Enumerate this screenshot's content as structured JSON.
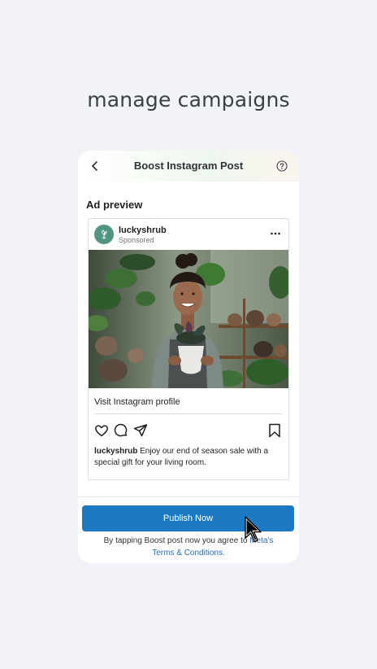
{
  "headline": "manage campaigns",
  "topbar": {
    "title": "Boost Instagram Post",
    "back_icon": "chevron-left-icon",
    "help_icon": "question-circle-icon"
  },
  "section_title": "Ad preview",
  "post": {
    "username": "luckyshrub",
    "sponsored": "Sponsored",
    "more_icon": "more-horizontal-icon",
    "image_alt": "Woman smiling holding a potted plant in a plant shop",
    "cta": "Visit Instagram profile",
    "icons": [
      "heart-icon",
      "comment-icon",
      "share-icon",
      "bookmark-icon"
    ],
    "caption_user": "luckyshrub",
    "caption_text": " Enjoy our end of season sale with a special gift for your living room."
  },
  "publish_label": "Publish Now",
  "terms": {
    "prefix": "By tapping Boost post now you agree to ",
    "link_a": "Meta's",
    "link_b": "Terms & Conditions."
  },
  "colors": {
    "accent": "#1c7ac4",
    "link": "#2a6db3",
    "avatar": "#4e9582",
    "background": "#f1f3f8"
  }
}
